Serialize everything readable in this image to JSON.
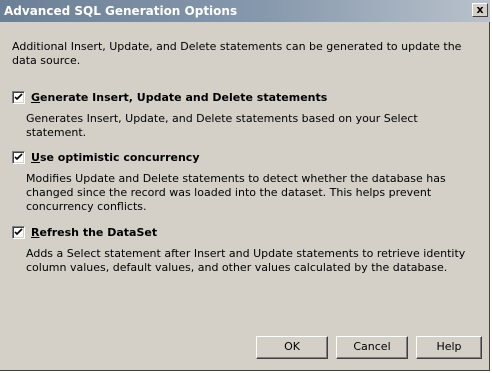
{
  "window": {
    "title": "Advanced SQL Generation Options",
    "close_label": "x"
  },
  "intro_text": "Additional Insert, Update, and Delete statements can be generated to update the data source.",
  "options": [
    {
      "label": "Generate Insert, Update and Delete statements",
      "mnemonic": "G",
      "checked": true,
      "description": "Generates Insert, Update, and Delete statements based on your Select statement."
    },
    {
      "label": "Use optimistic concurrency",
      "mnemonic": "U",
      "checked": true,
      "description": "Modifies Update and Delete statements to detect whether the database has changed since the record was loaded into the dataset. This helps prevent concurrency conflicts."
    },
    {
      "label": "Refresh the DataSet",
      "mnemonic": "R",
      "checked": true,
      "description": "Adds a Select statement after Insert and Update statements to retrieve identity column values, default values, and other values calculated by the database."
    }
  ],
  "buttons": {
    "ok": "OK",
    "cancel": "Cancel",
    "help": "Help"
  }
}
